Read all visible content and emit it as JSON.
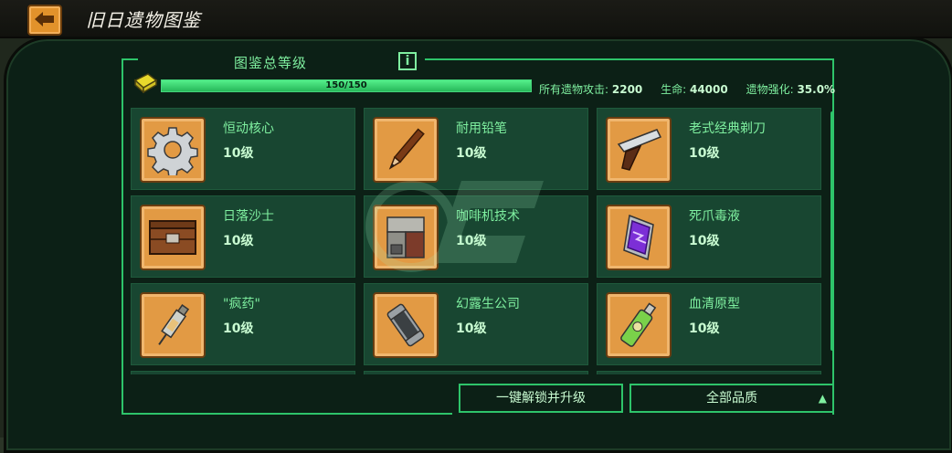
{
  "window": {
    "title": "旧日遗物图鉴"
  },
  "codex": {
    "section_title": "图鉴总等级",
    "info_label": "i",
    "progress": {
      "text": "150/150",
      "fraction": 1.0
    },
    "stats": [
      {
        "label": "所有遗物攻击:",
        "value": "2200"
      },
      {
        "label": "生命:",
        "value": "44000"
      },
      {
        "label": "遗物强化:",
        "value": "35.0%"
      }
    ]
  },
  "relics": [
    {
      "name": "恒动核心",
      "level": "10级",
      "icon": "gear-icon"
    },
    {
      "name": "耐用铅笔",
      "level": "10级",
      "icon": "pencil-icon"
    },
    {
      "name": "老式经典剃刀",
      "level": "10级",
      "icon": "razor-icon"
    },
    {
      "name": "日落沙士",
      "level": "10级",
      "icon": "crate-icon"
    },
    {
      "name": "咖啡机技术",
      "level": "10级",
      "icon": "coffee-machine-icon"
    },
    {
      "name": "死爪毒液",
      "level": "10级",
      "icon": "venom-pack-icon"
    },
    {
      "name": "\"疯药\"",
      "level": "10级",
      "icon": "syringe-icon"
    },
    {
      "name": "幻露生公司",
      "level": "10级",
      "icon": "canister-icon"
    },
    {
      "name": "血清原型",
      "level": "10级",
      "icon": "serum-vial-icon"
    }
  ],
  "footer": {
    "unlock_label": "一键解锁并升级",
    "quality_label": "全部品质"
  },
  "colors": {
    "accent": "#2ec46a",
    "tile": "#e29a44",
    "card": "#184631"
  }
}
